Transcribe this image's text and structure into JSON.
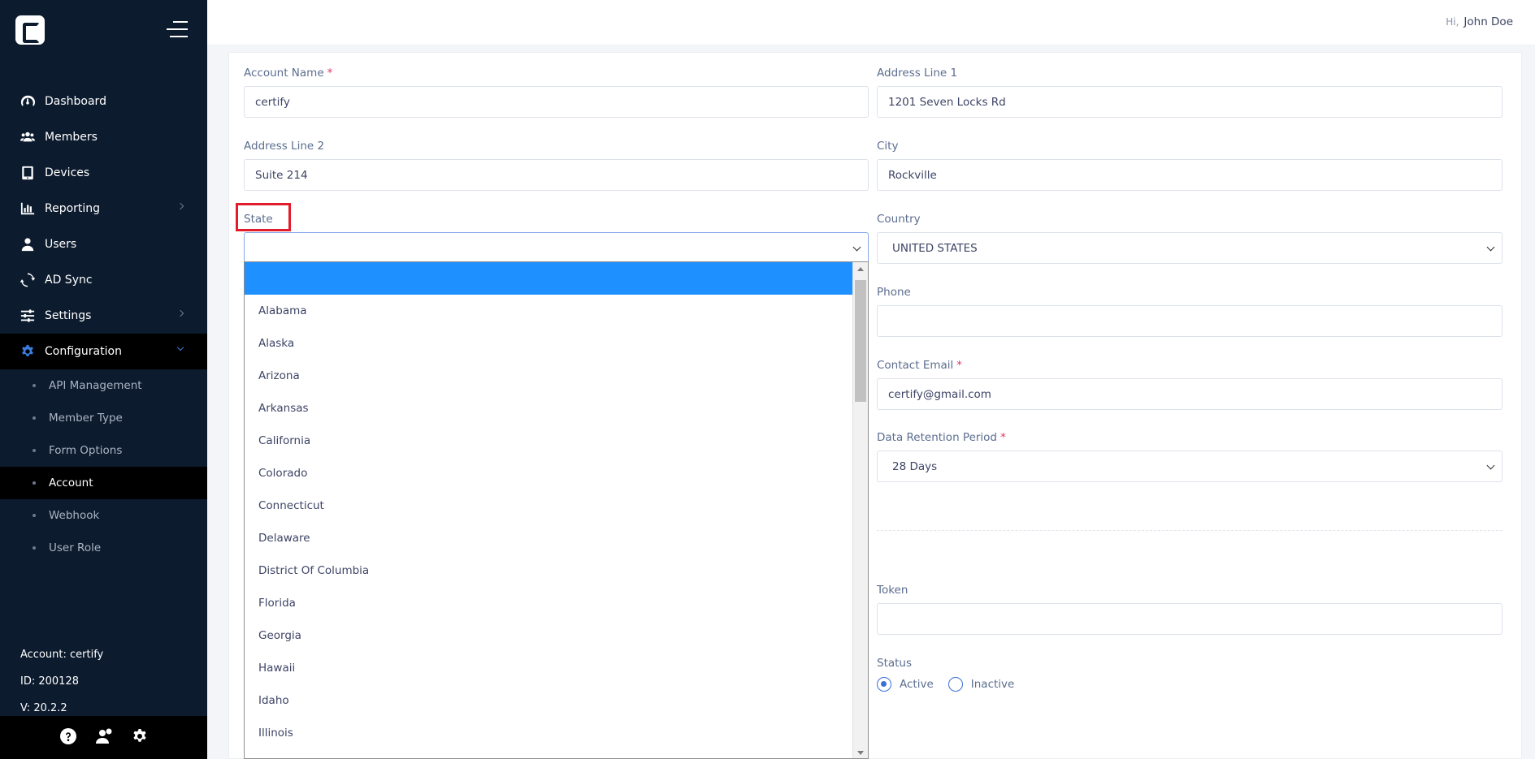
{
  "header": {
    "greeting_prefix": "Hi,",
    "user_name": "John Doe"
  },
  "sidebar": {
    "items": [
      {
        "label": "Dashboard",
        "icon": "dashboard-icon"
      },
      {
        "label": "Members",
        "icon": "members-icon"
      },
      {
        "label": "Devices",
        "icon": "tablet-icon"
      },
      {
        "label": "Reporting",
        "icon": "chart-icon"
      },
      {
        "label": "Users",
        "icon": "user-icon"
      },
      {
        "label": "AD Sync",
        "icon": "sync-icon"
      },
      {
        "label": "Settings",
        "icon": "sliders-icon"
      },
      {
        "label": "Configuration",
        "icon": "gear-icon"
      }
    ],
    "subitems": [
      {
        "label": "API Management"
      },
      {
        "label": "Member Type"
      },
      {
        "label": "Form Options"
      },
      {
        "label": "Account"
      },
      {
        "label": "Webhook"
      },
      {
        "label": "User Role"
      }
    ],
    "account_line": "Account: certify",
    "id_line": "ID: 200128",
    "version_line": "V: 20.2.2"
  },
  "form": {
    "account_name": {
      "label": "Account Name",
      "required": "*",
      "value": "certify"
    },
    "address1": {
      "label": "Address Line 1",
      "value": "1201 Seven Locks Rd"
    },
    "address2": {
      "label": "Address Line 2",
      "value": "Suite 214"
    },
    "city": {
      "label": "City",
      "value": "Rockville"
    },
    "state": {
      "label": "State",
      "value": ""
    },
    "country": {
      "label": "Country",
      "value": "UNITED STATES"
    },
    "phone": {
      "label": "Phone",
      "value": ""
    },
    "contact_email": {
      "label": "Contact Email",
      "required": "*",
      "value": "certify@gmail.com"
    },
    "retention": {
      "label": "Data Retention Period",
      "required": "*",
      "value": "28 Days"
    },
    "token": {
      "label": "Token",
      "value": ""
    },
    "status": {
      "label": "Status",
      "active": "Active",
      "inactive": "Inactive"
    }
  },
  "state_options": [
    "",
    "Alabama",
    "Alaska",
    "Arizona",
    "Arkansas",
    "California",
    "Colorado",
    "Connecticut",
    "Delaware",
    "District Of Columbia",
    "Florida",
    "Georgia",
    "Hawaii",
    "Idaho",
    "Illinois"
  ],
  "colors": {
    "sidebar_bg": "#0c1b2e",
    "accent": "#3b7ddd",
    "dropdown_selected": "#1e90ff",
    "required": "#e8336b",
    "highlight": "#e21c2a"
  }
}
